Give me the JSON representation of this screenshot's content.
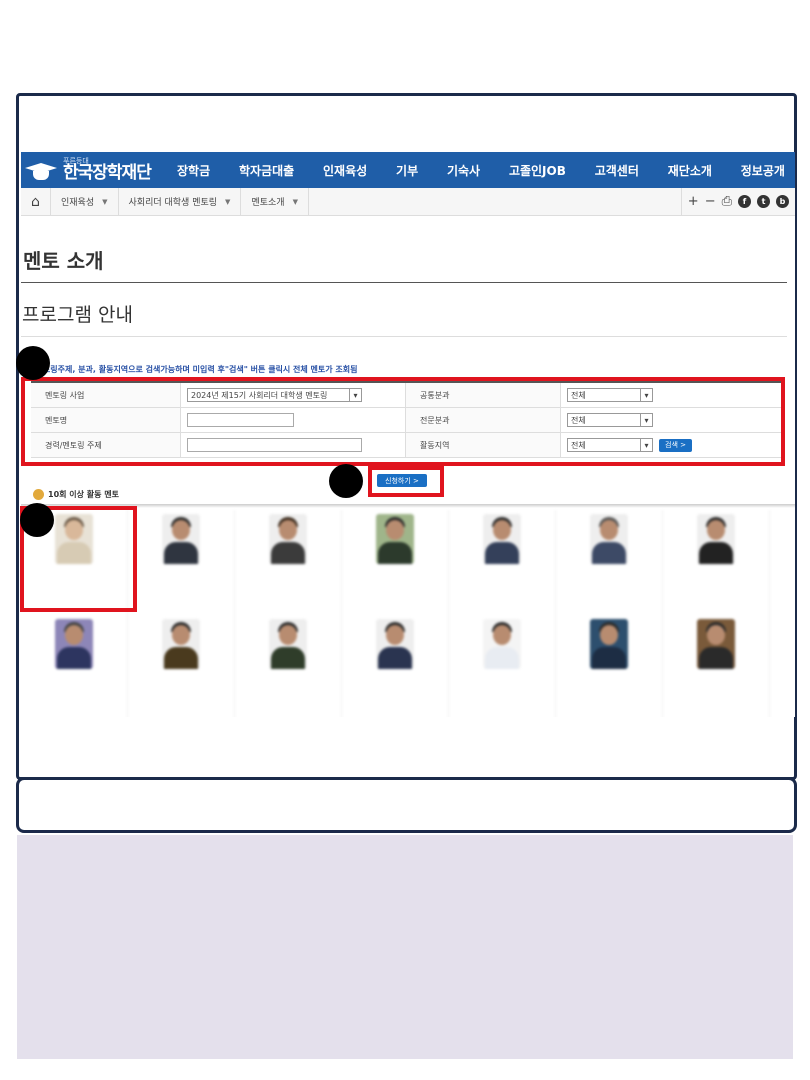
{
  "site": {
    "logo_sub": "푸른등대",
    "logo_main": "한국장학재단"
  },
  "menu": [
    "장학금",
    "학자금대출",
    "인재육성",
    "기부",
    "기숙사",
    "고졸인JOB",
    "고객센터",
    "재단소개",
    "정보공개"
  ],
  "breadcrumb": [
    "인재육성",
    "사회리더 대학생 멘토링",
    "멘토소개"
  ],
  "page_title": "멘토 소개",
  "section_title": "프로그램 안내",
  "notice": "※ 멘토링주제, 분과, 활동지역으로 검색가능하며 미입력 후\"검색\" 버튼 클릭시 전체 멘토가 조회됨",
  "form": {
    "row1": {
      "label": "멘토링 사업",
      "value": "2024년 제15기 사회리더 대학생 멘토링",
      "label2": "공통분과",
      "value2": "전체"
    },
    "row2": {
      "label": "멘토명",
      "value": "",
      "label2": "전문분과",
      "value2": "전체"
    },
    "row3": {
      "label": "경력/멘토링 주제",
      "value": "",
      "label2": "활동지역",
      "value2": "전체"
    },
    "search_button": "검색 >"
  },
  "apply_button": "신청하기 >",
  "mentor_section_title": "10회 이상 활동 멘토",
  "mentors": [
    {
      "line1": "",
      "line2": ""
    },
    {
      "line1": "",
      "line2": ""
    },
    {
      "line1": "",
      "line2": ""
    },
    {
      "line1": "",
      "line2": ""
    },
    {
      "line1": "",
      "line2": ""
    },
    {
      "line1": "",
      "line2": ""
    },
    {
      "line1": "",
      "line2": ""
    },
    {
      "line1": "",
      "line2": ""
    },
    {
      "line1": "",
      "line2": ""
    },
    {
      "line1": "",
      "line2": ""
    },
    {
      "line1": "",
      "line2": ""
    },
    {
      "line1": "",
      "line2": ""
    },
    {
      "line1": "",
      "line2": ""
    },
    {
      "line1": "",
      "line2": ""
    }
  ],
  "colors": {
    "nav_blue": "#1f5ea8",
    "annotation_red": "#e0141e",
    "frame_navy": "#1b2a4a",
    "lavender_panel": "#e4e0ec"
  }
}
